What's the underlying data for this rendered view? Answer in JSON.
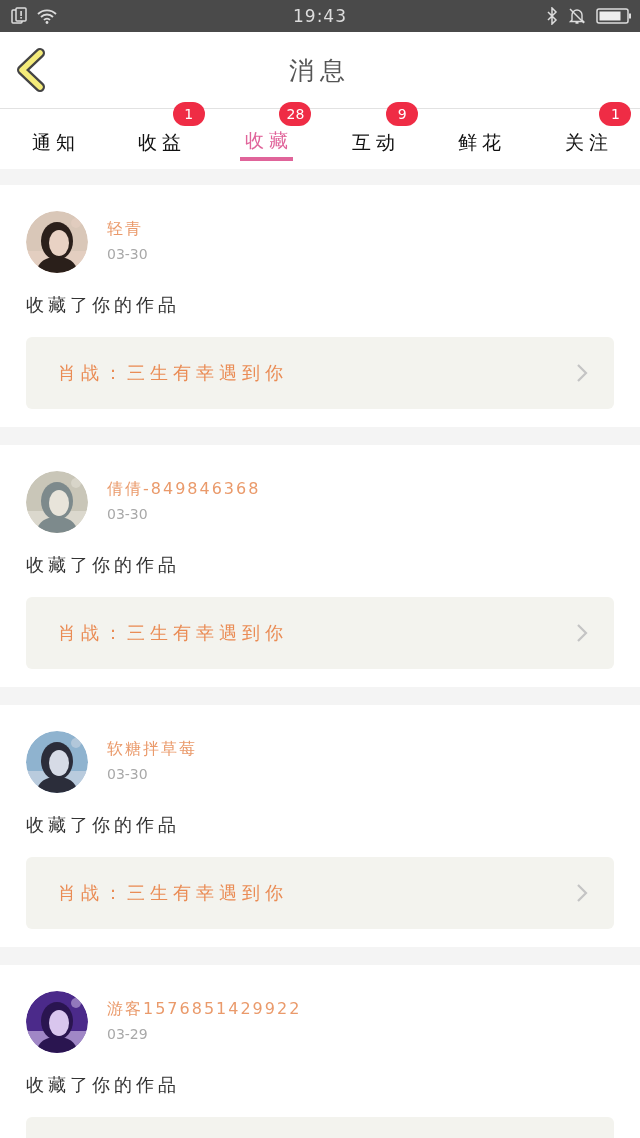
{
  "status_bar": {
    "time": "19:43"
  },
  "header": {
    "title": "消息"
  },
  "tabs": [
    {
      "label": "通知",
      "selected": false
    },
    {
      "label": "收益",
      "selected": false,
      "badge": "1"
    },
    {
      "label": "收藏",
      "selected": true,
      "badge": "28"
    },
    {
      "label": "互动",
      "selected": false,
      "badge": "9"
    },
    {
      "label": "鲜花",
      "selected": false
    },
    {
      "label": "关注",
      "selected": false,
      "badge": "1"
    }
  ],
  "messages": [
    {
      "user": "轻青",
      "date": "03-30",
      "text": "收藏了你的作品",
      "work": "肖战：三生有幸遇到你"
    },
    {
      "user": "倩倩-849846368",
      "date": "03-30",
      "text": "收藏了你的作品",
      "work": "肖战：三生有幸遇到你"
    },
    {
      "user": "软糖拌草莓",
      "date": "03-30",
      "text": "收藏了你的作品",
      "work": "肖战：三生有幸遇到你"
    },
    {
      "user": "游客1576851429922",
      "date": "03-29",
      "text": "收藏了你的作品"
    }
  ]
}
